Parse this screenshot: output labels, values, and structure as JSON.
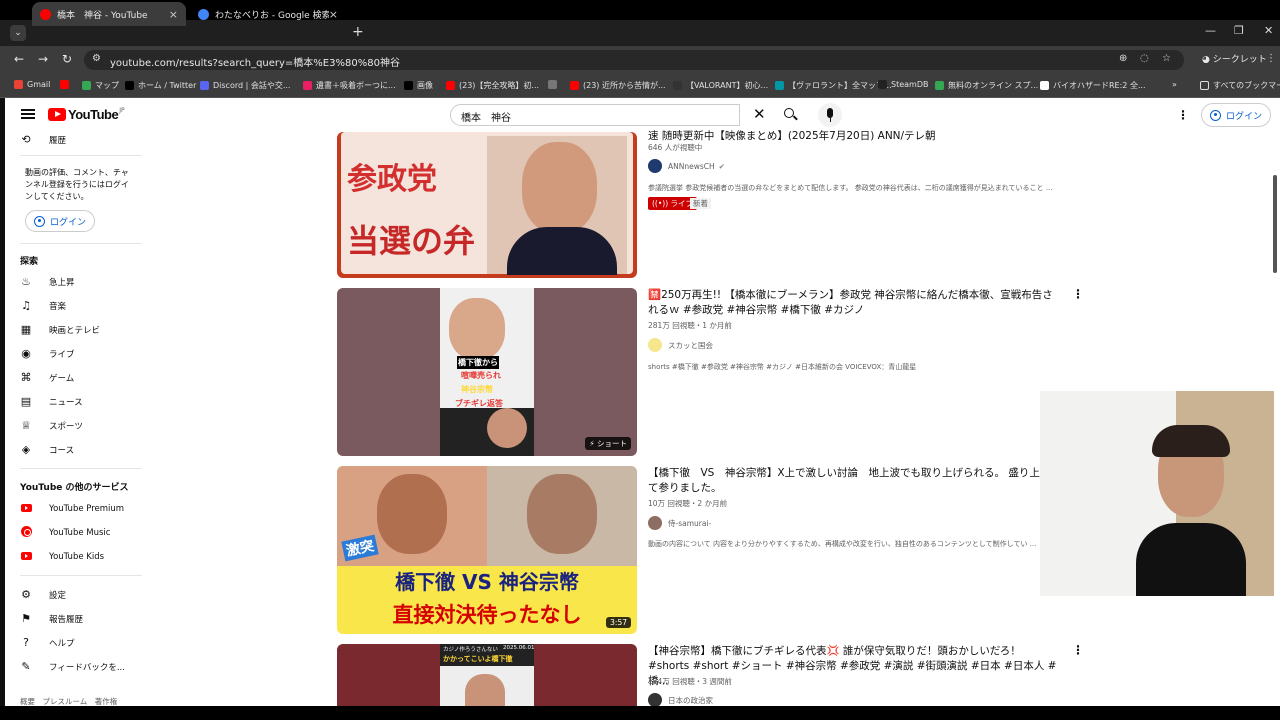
{
  "browser": {
    "tabs": [
      {
        "title": "橋本　神谷 - YouTube",
        "active": true,
        "favicon_color": "#ff0000"
      },
      {
        "title": "わたなべりお - Google 検索",
        "active": false,
        "favicon_color": "#4285f4"
      }
    ],
    "url": "youtube.com/results?search_query=橋本%E3%80%80神谷",
    "incognito_label": "シークレット",
    "bookmarks": [
      {
        "label": "Gmail",
        "color": "#ea4335"
      },
      {
        "label": "",
        "color": "#ff0000"
      },
      {
        "label": "マップ",
        "color": "#34a853"
      },
      {
        "label": "ホーム / Twitter",
        "color": "#000000"
      },
      {
        "label": "Discord | 会話や交...",
        "color": "#5865f2"
      },
      {
        "label": "遺書＋吸着ボーつに...",
        "color": "#e91e63"
      },
      {
        "label": "画像",
        "color": "#000000"
      },
      {
        "label": "(23)【完全攻略】初...",
        "color": "#ff0000"
      },
      {
        "label": "",
        "color": "#777777"
      },
      {
        "label": "(23) 近所から苦情が...",
        "color": "#ff0000"
      },
      {
        "label": "【VALORANT】初心...",
        "color": "#333333"
      },
      {
        "label": "【ヴァロラント】全マップ...",
        "color": "#0097a7"
      },
      {
        "label": "SteamDB",
        "color": "#222222"
      },
      {
        "label": "無料のオンライン スプ...",
        "color": "#34a853"
      },
      {
        "label": "バイオハザードRE:2 全...",
        "color": "#ffffff"
      }
    ],
    "all_bookmarks": "すべてのブックマーク"
  },
  "youtube": {
    "logo_text": "YouTube",
    "logo_sup": "JP",
    "search_query": "橋本　神谷",
    "login_label": "ログイン",
    "sidebar": {
      "history": "履歴",
      "note": "動画の評価、コメント、チャンネル登録を行うにはログインしてください。",
      "login": "ログイン",
      "explore_header": "探索",
      "explore": [
        "急上昇",
        "音楽",
        "映画とテレビ",
        "ライブ",
        "ゲーム",
        "ニュース",
        "スポーツ",
        "コース"
      ],
      "services_header": "YouTube の他のサービス",
      "services": [
        "YouTube Premium",
        "YouTube Music",
        "YouTube Kids"
      ],
      "settings": [
        "設定",
        "報告履歴",
        "ヘルプ",
        "フィードバックを..."
      ],
      "footer": "概要　プレスルーム　著作権"
    },
    "videos": [
      {
        "title": "速 随時更新中【映像まとめ】(2025年7月20日) ANN/テレ朝",
        "meta": "646 人が視聴中",
        "channel": "ANNnewsCH",
        "desc": "参議院選挙 参政党候補者の当選の弁などをまとめて配信します。 参政党の神谷代表は、二桁の議席獲得が見込まれていること ...",
        "badge_live": "ライブ",
        "badge_new": "新着",
        "thumb_text": [
          "参政党",
          "当選の弁"
        ]
      },
      {
        "title": "🈲250万再生!! 【橋本徹にブーメラン】参政党 神谷宗幣に絡んだ橋本徹、宣戦布告されるｗ #参政党 #神谷宗幣 #橋下徹 #カジノ",
        "meta": "281万 回視聴・1 か月前",
        "channel": "スカッと国会",
        "desc": "shorts #橋下徹 #参政党 #神谷宗幣 #カジノ #日本維新の会 VOICEVOX：青山龍星",
        "shorts_label": "ショート",
        "thumb_text": [
          "橋下徹から",
          "喧嘩売られ",
          "神谷宗幣",
          "ブチギレ返答"
        ]
      },
      {
        "title": "【橋下徹　VS　神谷宗幣】X上で激しい討論　地上波でも取り上げられる。 盛り上がって参りました。",
        "meta": "10万 回視聴・2 か月前",
        "channel": "侍-samurai-",
        "desc": "動画の内容について 内容をより分かりやすくするため、再構成や改変を行い、独自性のあるコンテンツとして制作してい ...",
        "duration": "3:57",
        "thumb_text": [
          "激突",
          "橋下徹 VS 神谷宗幣",
          "直接対決待ったなし"
        ]
      },
      {
        "title": "【神谷宗幣】橋下徹にブチギレる代表💢 誰が保守気取りだ！頭おかしいだろ！ #shorts #short #ショート #神谷宗幣 #参政党 #演説 #街頭演説 #日本 #日本人 #橋...",
        "meta": "124万 回視聴・3 週間前",
        "channel": "日本の政治家",
        "thumb_text": [
          "カジノ作ろうさんない",
          "2025.06.01",
          "かかってこいよ橋下徹"
        ]
      }
    ]
  }
}
